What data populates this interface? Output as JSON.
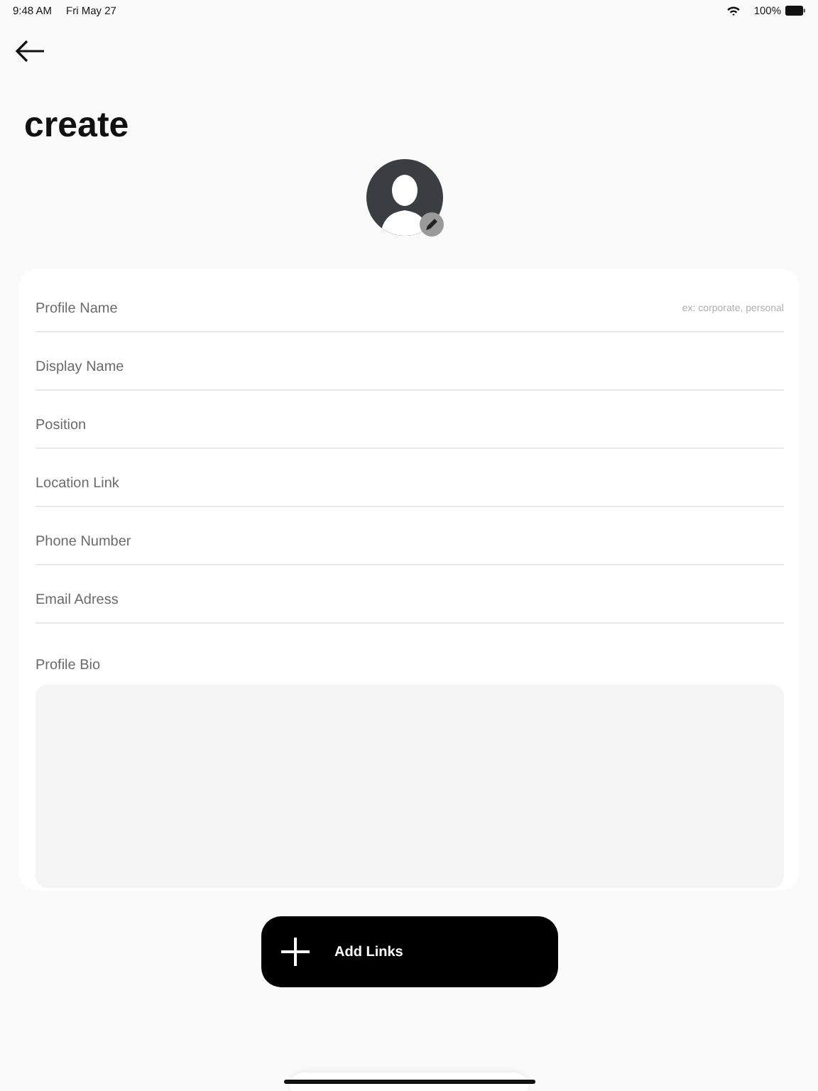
{
  "status_bar": {
    "time": "9:48 AM",
    "date": "Fri May 27",
    "battery": "100%"
  },
  "title": "create",
  "fields": [
    {
      "placeholder": "Profile Name",
      "hint": "ex: corporate, personal"
    },
    {
      "placeholder": "Display Name"
    },
    {
      "placeholder": "Position"
    },
    {
      "placeholder": "Location Link"
    },
    {
      "placeholder": "Phone Number"
    },
    {
      "placeholder": "Email Adress"
    }
  ],
  "bio": {
    "label": "Profile Bio"
  },
  "add_button": {
    "label": "Add Links"
  }
}
